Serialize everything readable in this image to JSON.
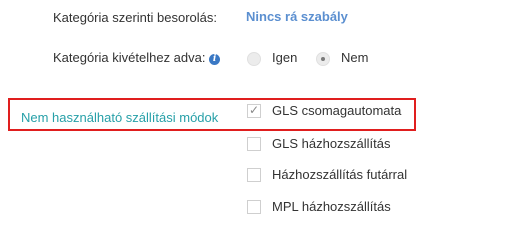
{
  "category_classification": {
    "label": "Kategória szerinti besorolás:",
    "value": "Nincs rá szabály"
  },
  "category_exception": {
    "label": "Kategória kivételhez adva:",
    "info_icon": "info-icon",
    "options": [
      {
        "label": "Igen",
        "selected": false
      },
      {
        "label": "Nem",
        "selected": true
      }
    ]
  },
  "shipping_methods": {
    "label": "Nem használható szállítási módok",
    "highlight_color": "#e01e1e",
    "label_color": "#27a0a8",
    "items": [
      {
        "label": "GLS csomagautomata",
        "checked": true
      },
      {
        "label": "GLS házhozszállítás",
        "checked": false
      },
      {
        "label": "Házhozszállítás futárral",
        "checked": false
      },
      {
        "label": "MPL házhozszállítás",
        "checked": false
      }
    ]
  }
}
